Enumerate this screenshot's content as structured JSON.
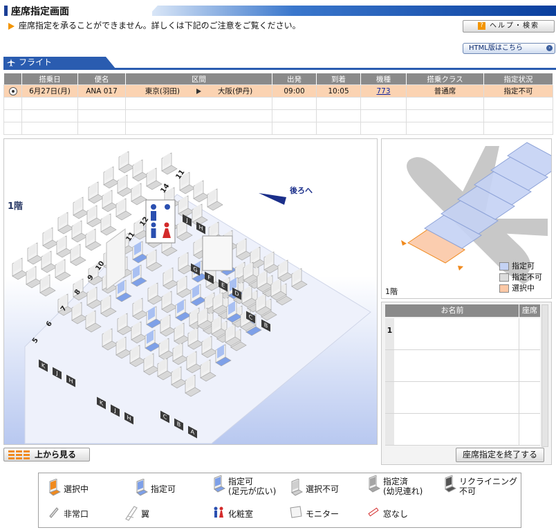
{
  "header": {
    "title": "座席指定画面"
  },
  "notice": {
    "text": "座席指定を承ることができません。詳しくは下記のご注意をご覧ください。"
  },
  "buttons": {
    "help": "ヘルプ・検索",
    "html_version": "HTML版はこちら",
    "top_view": "上から見る",
    "finish": "座席指定を終了する"
  },
  "flight_tab": {
    "label": "フライト"
  },
  "flight_table": {
    "headers": [
      "",
      "搭乗日",
      "便名",
      "区間",
      "出発",
      "到着",
      "機種",
      "搭乗クラス",
      "指定状況"
    ],
    "row": {
      "date": "6月27日(月)",
      "flight_no": "ANA 017",
      "from": "東京(羽田)",
      "to": "大阪(伊丹)",
      "depart": "09:00",
      "arrive": "10:05",
      "aircraft": "773",
      "class": "普通席",
      "status": "指定不可"
    }
  },
  "seat_map": {
    "floor": "1階",
    "rear_label": "後ろへ",
    "row_numbers": [
      "5",
      "6",
      "7",
      "8",
      "9",
      "10",
      "11",
      "12",
      "14"
    ],
    "row_number_top": "11",
    "seat_letters_center": [
      "G",
      "F",
      "E",
      "D"
    ],
    "seat_letters_right": [
      "C",
      "B"
    ],
    "seat_letters_left": [
      "J",
      "H"
    ],
    "seat_letters_right2": [
      "C",
      "B",
      "A"
    ],
    "seat_letters_left2": [
      "K",
      "J",
      "H"
    ],
    "row_letters_bottom": [
      "K",
      "J",
      "H"
    ]
  },
  "overview": {
    "floor": "1階",
    "legend": [
      {
        "label": "指定可",
        "color": "#c4d2f4"
      },
      {
        "label": "指定不可",
        "color": "#dcdcdc"
      },
      {
        "label": "選択中",
        "color": "#fbc8a6"
      }
    ]
  },
  "name_panel": {
    "col_name": "お名前",
    "col_seat": "座席",
    "rows": [
      "1",
      "",
      "",
      ""
    ]
  },
  "legend": {
    "items": [
      {
        "label": "選択中",
        "icon": "selected-seat-icon"
      },
      {
        "label": "指定可",
        "icon": "available-seat-icon"
      },
      {
        "label": "指定可\n(足元が広い)",
        "icon": "wide-legroom-seat-icon"
      },
      {
        "label": "選択不可",
        "icon": "unavailable-seat-icon"
      },
      {
        "label": "指定済\n(幼児連れ)",
        "icon": "infant-seat-icon"
      },
      {
        "label": "リクライニング\n不可",
        "icon": "no-recline-seat-icon"
      },
      {
        "label": "非常口",
        "icon": "emergency-exit-icon"
      },
      {
        "label": "翼",
        "icon": "wing-icon"
      },
      {
        "label": "化粧室",
        "icon": "lavatory-icon"
      },
      {
        "label": "モニター",
        "icon": "monitor-icon"
      },
      {
        "label": "窓なし",
        "icon": "no-window-icon"
      }
    ]
  }
}
